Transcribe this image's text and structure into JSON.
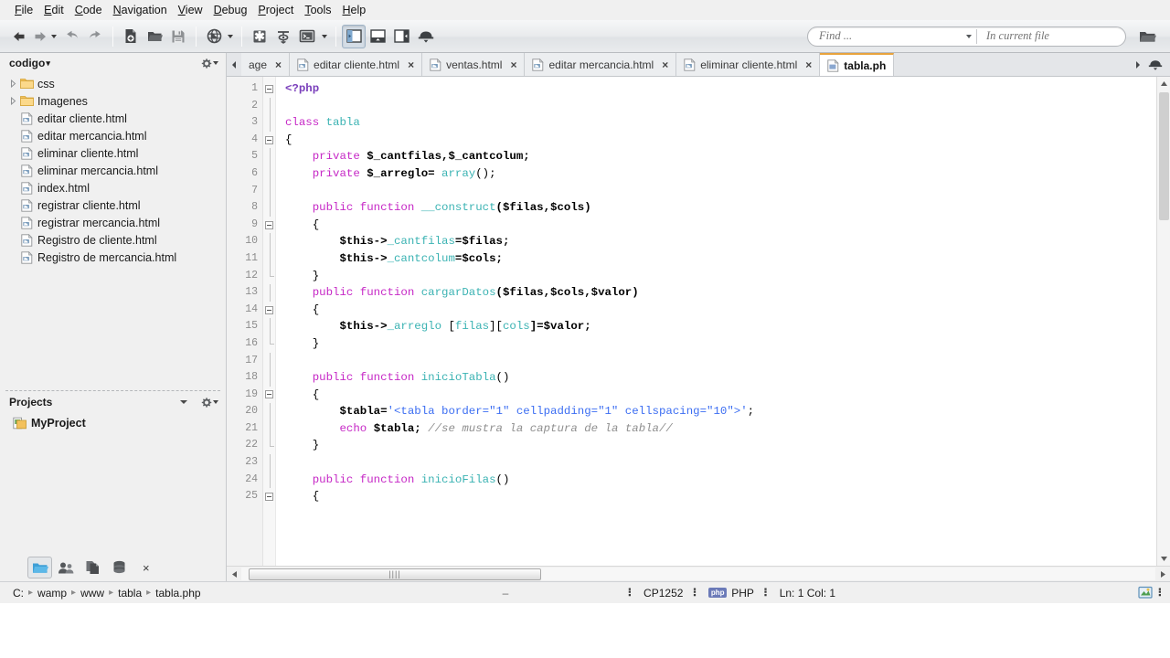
{
  "menubar": {
    "items": [
      {
        "acc": "F",
        "rest": "ile"
      },
      {
        "acc": "E",
        "rest": "dit"
      },
      {
        "acc": "C",
        "rest": "ode"
      },
      {
        "acc": "N",
        "rest": "avigation"
      },
      {
        "acc": "V",
        "rest": "iew"
      },
      {
        "acc": "D",
        "rest": "ebug"
      },
      {
        "acc": "P",
        "rest": "roject"
      },
      {
        "acc": "T",
        "rest": "ools"
      },
      {
        "acc": "H",
        "rest": "elp"
      }
    ]
  },
  "toolbar": {
    "buttons": [
      {
        "name": "back-icon"
      },
      {
        "name": "forward-icon"
      },
      {
        "name": "undo-icon"
      },
      {
        "name": "redo-icon"
      },
      {
        "name": "new-file-icon"
      },
      {
        "name": "open-folder-icon"
      },
      {
        "name": "save-icon"
      },
      {
        "name": "preview-browser-icon"
      },
      {
        "name": "debug-icon"
      },
      {
        "name": "step-over-icon"
      },
      {
        "name": "console-icon"
      },
      {
        "name": "toggle-left-pane-icon"
      },
      {
        "name": "toggle-bottom-pane-icon"
      },
      {
        "name": "toggle-right-pane-icon"
      },
      {
        "name": "toggle-toolbar-icon"
      },
      {
        "name": "open-project-folder-icon"
      }
    ],
    "search": {
      "find_placeholder": "Find ...",
      "scope_placeholder": "In current file"
    }
  },
  "sidebar": {
    "header": {
      "title": "codigo",
      "caret": "▾",
      "gear": "gear-icon"
    },
    "tree": [
      {
        "type": "folder",
        "label": "css",
        "expandable": true
      },
      {
        "type": "folder",
        "label": "Imagenes",
        "expandable": true
      },
      {
        "type": "file",
        "label": "editar cliente.html"
      },
      {
        "type": "file",
        "label": "editar mercancia.html"
      },
      {
        "type": "file",
        "label": "eliminar cliente.html"
      },
      {
        "type": "file",
        "label": "eliminar mercancia.html"
      },
      {
        "type": "file",
        "label": "index.html"
      },
      {
        "type": "file",
        "label": "registrar cliente.html"
      },
      {
        "type": "file",
        "label": "registrar mercancia.html"
      },
      {
        "type": "file",
        "label": "Registro de cliente.html"
      },
      {
        "type": "file",
        "label": "Registro de mercancia.html"
      }
    ],
    "projects": {
      "title": "Projects",
      "items": [
        {
          "label": "MyProject"
        }
      ]
    },
    "bottom_tabs": [
      {
        "name": "files-tab",
        "active": true
      },
      {
        "name": "people-tab",
        "active": false
      },
      {
        "name": "copy-tab",
        "active": false
      },
      {
        "name": "database-tab",
        "active": false
      }
    ],
    "close_label": "×"
  },
  "editor": {
    "tabs": [
      {
        "label": "age",
        "active": false,
        "truncated": true,
        "icon": "html-file-icon"
      },
      {
        "label": "editar cliente.html",
        "active": false,
        "icon": "html-file-icon"
      },
      {
        "label": "ventas.html",
        "active": false,
        "icon": "html-file-icon"
      },
      {
        "label": "editar mercancia.html",
        "active": false,
        "icon": "html-file-icon"
      },
      {
        "label": "eliminar cliente.html",
        "active": false,
        "icon": "html-file-icon"
      },
      {
        "label": "tabla.ph",
        "active": true,
        "icon": "php-file-icon"
      }
    ],
    "tab_close_label": "×",
    "line_numbers": [
      "1",
      "2",
      "3",
      "4",
      "5",
      "6",
      "7",
      "8",
      "9",
      "10",
      "11",
      "12",
      "13",
      "14",
      "15",
      "16",
      "17",
      "18",
      "19",
      "20",
      "21",
      "22",
      "23",
      "24",
      "25"
    ],
    "code_lines": [
      {
        "n": 1,
        "tokens": [
          {
            "t": "<?php",
            "c": "tagname"
          }
        ]
      },
      {
        "n": 2,
        "tokens": []
      },
      {
        "n": 3,
        "tokens": [
          {
            "t": "class ",
            "c": "kw"
          },
          {
            "t": "tabla",
            "c": "cls"
          }
        ]
      },
      {
        "n": 4,
        "tokens": [
          {
            "t": "{",
            "c": "pt"
          }
        ]
      },
      {
        "n": 5,
        "tokens": [
          {
            "t": "    ",
            "c": "pt"
          },
          {
            "t": "private ",
            "c": "kw"
          },
          {
            "t": "$_cantfilas,$_cantcolum;",
            "c": "var"
          }
        ]
      },
      {
        "n": 6,
        "tokens": [
          {
            "t": "    ",
            "c": "pt"
          },
          {
            "t": "private ",
            "c": "kw"
          },
          {
            "t": "$_arreglo= ",
            "c": "var"
          },
          {
            "t": "array",
            "c": "cls"
          },
          {
            "t": "();",
            "c": "pt"
          }
        ]
      },
      {
        "n": 7,
        "tokens": []
      },
      {
        "n": 8,
        "tokens": [
          {
            "t": "    ",
            "c": "pt"
          },
          {
            "t": "public function ",
            "c": "kw"
          },
          {
            "t": "__construct",
            "c": "cls"
          },
          {
            "t": "($filas,$cols)",
            "c": "var"
          }
        ]
      },
      {
        "n": 9,
        "tokens": [
          {
            "t": "    {",
            "c": "pt"
          }
        ]
      },
      {
        "n": 10,
        "tokens": [
          {
            "t": "        ",
            "c": "pt"
          },
          {
            "t": "$this->",
            "c": "idb"
          },
          {
            "t": "_cantfilas",
            "c": "cls"
          },
          {
            "t": "=$filas;",
            "c": "var"
          }
        ]
      },
      {
        "n": 11,
        "tokens": [
          {
            "t": "        ",
            "c": "pt"
          },
          {
            "t": "$this->",
            "c": "idb"
          },
          {
            "t": "_cantcolum",
            "c": "cls"
          },
          {
            "t": "=$cols;",
            "c": "var"
          }
        ]
      },
      {
        "n": 12,
        "tokens": [
          {
            "t": "    }",
            "c": "pt"
          }
        ]
      },
      {
        "n": 13,
        "tokens": [
          {
            "t": "    ",
            "c": "pt"
          },
          {
            "t": "public function ",
            "c": "kw"
          },
          {
            "t": "cargarDatos",
            "c": "cls"
          },
          {
            "t": "($filas,$cols,$valor)",
            "c": "var"
          }
        ]
      },
      {
        "n": 14,
        "tokens": [
          {
            "t": "    {",
            "c": "pt"
          }
        ]
      },
      {
        "n": 15,
        "tokens": [
          {
            "t": "        ",
            "c": "pt"
          },
          {
            "t": "$this->",
            "c": "idb"
          },
          {
            "t": "_arreglo ",
            "c": "cls"
          },
          {
            "t": "[",
            "c": "pt"
          },
          {
            "t": "filas",
            "c": "cls"
          },
          {
            "t": "][",
            "c": "pt"
          },
          {
            "t": "cols",
            "c": "cls"
          },
          {
            "t": "]=$valor;",
            "c": "var"
          }
        ]
      },
      {
        "n": 16,
        "tokens": [
          {
            "t": "    }",
            "c": "pt"
          }
        ]
      },
      {
        "n": 17,
        "tokens": []
      },
      {
        "n": 18,
        "tokens": [
          {
            "t": "    ",
            "c": "pt"
          },
          {
            "t": "public function ",
            "c": "kw"
          },
          {
            "t": "inicioTabla",
            "c": "cls"
          },
          {
            "t": "()",
            "c": "pt"
          }
        ]
      },
      {
        "n": 19,
        "tokens": [
          {
            "t": "    {",
            "c": "pt"
          }
        ]
      },
      {
        "n": 20,
        "tokens": [
          {
            "t": "        ",
            "c": "pt"
          },
          {
            "t": "$tabla=",
            "c": "var"
          },
          {
            "t": "'<tabla border=\"1\" cellpadding=\"1\" cellspacing=\"10\">'",
            "c": "str"
          },
          {
            "t": ";",
            "c": "pt"
          }
        ]
      },
      {
        "n": 21,
        "tokens": [
          {
            "t": "        ",
            "c": "pt"
          },
          {
            "t": "echo ",
            "c": "kw"
          },
          {
            "t": "$tabla;",
            "c": "var"
          },
          {
            "t": " //se mustra la captura de la tabla//",
            "c": "cmt"
          }
        ]
      },
      {
        "n": 22,
        "tokens": [
          {
            "t": "    }",
            "c": "pt"
          }
        ]
      },
      {
        "n": 23,
        "tokens": []
      },
      {
        "n": 24,
        "tokens": [
          {
            "t": "    ",
            "c": "pt"
          },
          {
            "t": "public function ",
            "c": "kw"
          },
          {
            "t": "inicioFilas",
            "c": "cls"
          },
          {
            "t": "()",
            "c": "pt"
          }
        ]
      },
      {
        "n": 25,
        "tokens": [
          {
            "t": "    {",
            "c": "pt"
          }
        ]
      }
    ],
    "fold_markers": [
      1,
      4,
      9,
      14,
      19,
      25
    ],
    "hscroll_grip": "||||"
  },
  "statusbar": {
    "path": [
      "C:",
      "wamp",
      "www",
      "tabla",
      "tabla.php"
    ],
    "path_separator": "▸",
    "message": "–",
    "encoding": "CP1252",
    "language": "PHP",
    "language_badge": "php",
    "caret": "Ln: 1 Col: 1",
    "separator": "⠇"
  },
  "colors": {
    "accent_tab": "#e8a33d",
    "folder": "#f6cb6a",
    "keyword": "#c628c6",
    "classname": "#3bb3b3",
    "string": "#3c6ef2",
    "comment": "#8f8f8f",
    "php_tag": "#7a3fbb",
    "toolbar_bg": "#e8eaec"
  }
}
